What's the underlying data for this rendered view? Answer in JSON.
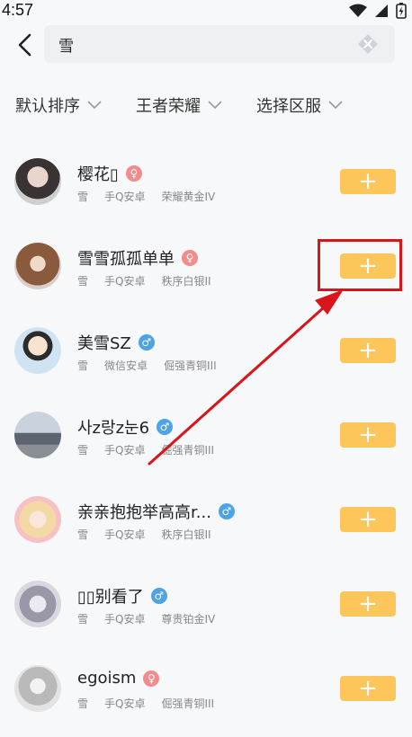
{
  "status_bar": {
    "time": "4:57"
  },
  "search": {
    "query": "雪"
  },
  "filters": [
    {
      "label": "默认排序"
    },
    {
      "label": "王者荣耀"
    },
    {
      "label": "选择区服"
    }
  ],
  "users": [
    {
      "name": "樱花▯",
      "gender": "female",
      "area": "雪",
      "platform": "手Q安卓",
      "rank": "荣耀黄金IV",
      "add_label": "+"
    },
    {
      "name": "雪雪孤孤单单",
      "gender": "female",
      "area": "雪",
      "platform": "手Q安卓",
      "rank": "秩序白银II",
      "add_label": "+"
    },
    {
      "name": "美雪SZ",
      "gender": "male",
      "area": "雪",
      "platform": "微信安卓",
      "rank": "倔强青铜III",
      "add_label": "+"
    },
    {
      "name": "사z랑z눈6",
      "gender": "male",
      "area": "雪",
      "platform": "手Q安卓",
      "rank": "倔强青铜III",
      "add_label": "+"
    },
    {
      "name": "亲亲抱抱举高高r...",
      "gender": "male",
      "area": "雪",
      "platform": "手Q安卓",
      "rank": "秩序白银II",
      "add_label": "+"
    },
    {
      "name": "▯▯别看了",
      "gender": "male",
      "area": "雪",
      "platform": "手Q安卓",
      "rank": "尊贵铂金IV",
      "add_label": "+"
    },
    {
      "name": "egoism",
      "gender": "female",
      "area": "雪",
      "platform": "手Q安卓",
      "rank": "倔强青铜III",
      "add_label": "+"
    }
  ],
  "colors": {
    "add_button": "#fcc65a",
    "highlight": "#d9141a",
    "female": "#f28b8b",
    "male": "#4da3e6"
  }
}
